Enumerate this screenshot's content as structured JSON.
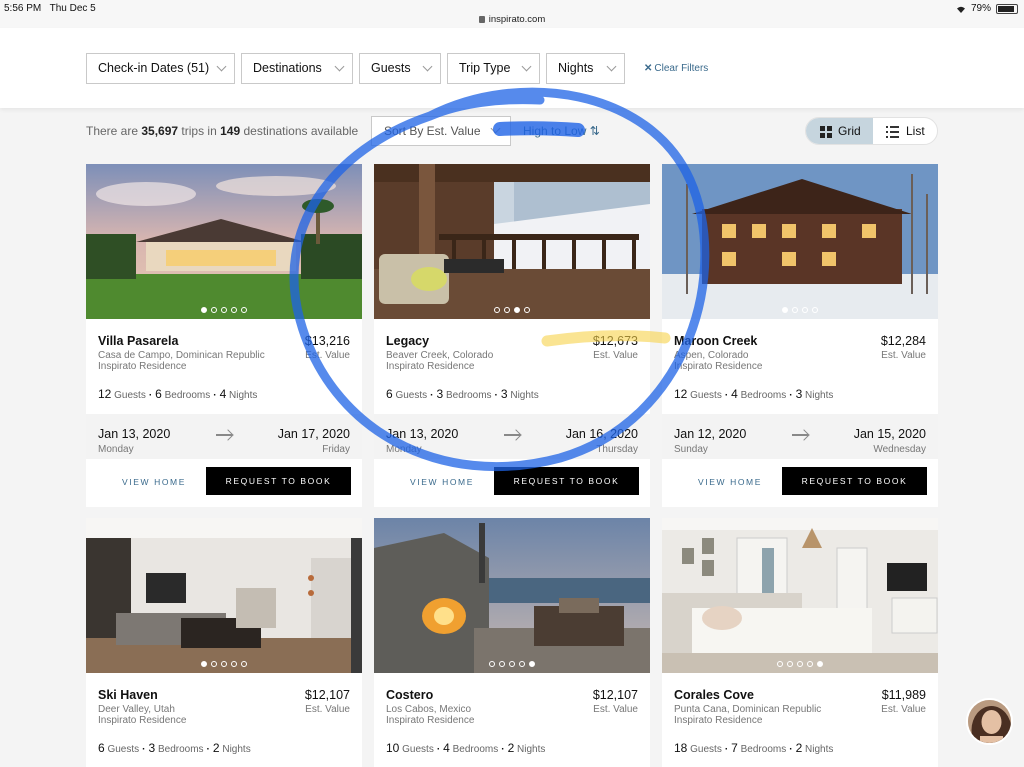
{
  "status": {
    "time": "5:56 PM",
    "date": "Thu Dec 5",
    "url": "inspirato.com",
    "battery": "79%"
  },
  "filters": [
    {
      "label": "Check-in Dates (51)"
    },
    {
      "label": "Destinations"
    },
    {
      "label": "Guests"
    },
    {
      "label": "Trip Type"
    },
    {
      "label": "Nights"
    }
  ],
  "clear_filters": "Clear Filters",
  "results": {
    "prefix": "There are",
    "trips": "35,697",
    "mid": "trips in",
    "destinations": "149",
    "suffix": "destinations available"
  },
  "sort": {
    "label": "Sort By Est. Value",
    "order": "High to Low"
  },
  "view": {
    "grid": "Grid",
    "list": "List"
  },
  "labels": {
    "est_value": "Est. Value",
    "guests": "Guests",
    "bedrooms": "Bedrooms",
    "nights": "Nights",
    "view_home": "VIEW HOME",
    "request_to_book": "REQUEST TO BOOK"
  },
  "cards": [
    {
      "name": "Villa Pasarela",
      "location": "Casa de Campo, Dominican Republic",
      "type": "Inspirato Residence",
      "price": "$13,216",
      "guests": "12",
      "bedrooms": "6",
      "nights": "4",
      "checkin": "Jan 13, 2020",
      "checkin_day": "Monday",
      "checkout": "Jan 17, 2020",
      "checkout_day": "Friday"
    },
    {
      "name": "Legacy",
      "location": "Beaver Creek, Colorado",
      "type": "Inspirato Residence",
      "price": "$12,673",
      "guests": "6",
      "bedrooms": "3",
      "nights": "3",
      "checkin": "Jan 13, 2020",
      "checkin_day": "Monday",
      "checkout": "Jan 16, 2020",
      "checkout_day": "Thursday"
    },
    {
      "name": "Maroon Creek",
      "location": "Aspen, Colorado",
      "type": "Inspirato Residence",
      "price": "$12,284",
      "guests": "12",
      "bedrooms": "4",
      "nights": "3",
      "checkin": "Jan 12, 2020",
      "checkin_day": "Sunday",
      "checkout": "Jan 15, 2020",
      "checkout_day": "Wednesday"
    },
    {
      "name": "Ski Haven",
      "location": "Deer Valley, Utah",
      "type": "Inspirato Residence",
      "price": "$12,107",
      "guests": "6",
      "bedrooms": "3",
      "nights": "2"
    },
    {
      "name": "Costero",
      "location": "Los Cabos, Mexico",
      "type": "Inspirato Residence",
      "price": "$12,107",
      "guests": "10",
      "bedrooms": "4",
      "nights": "2"
    },
    {
      "name": "Corales Cove",
      "location": "Punta Cana, Dominican Republic",
      "type": "Inspirato Residence",
      "price": "$11,989",
      "guests": "18",
      "bedrooms": "7",
      "nights": "2"
    }
  ]
}
